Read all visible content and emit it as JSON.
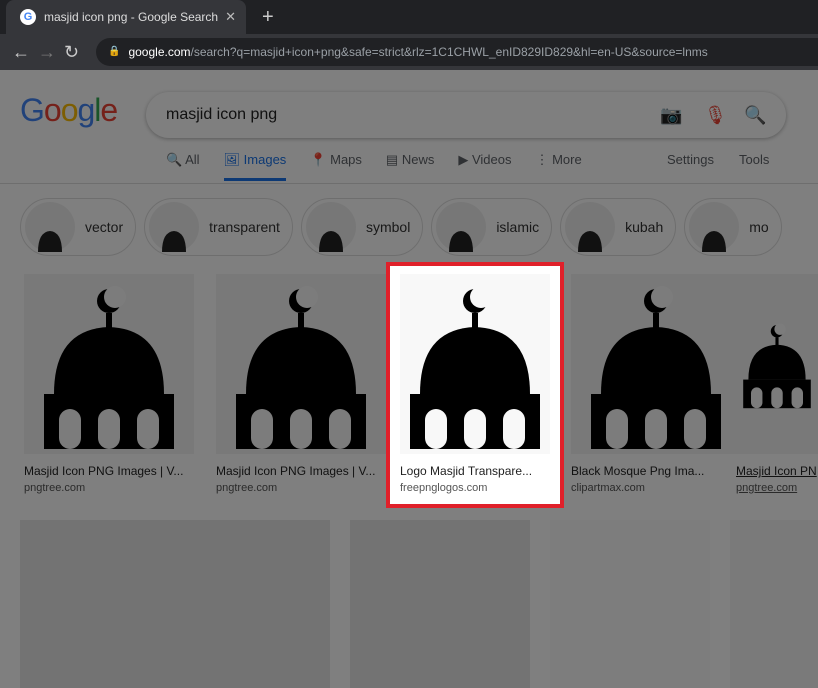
{
  "browser": {
    "tab_title": "masjid icon png - Google Search",
    "url_host": "google.com",
    "url_path": "/search?q=masjid+icon+png&safe=strict&rlz=1C1CHWL_enID829ID829&hl=en-US&source=lnms"
  },
  "search": {
    "query": "masjid icon png"
  },
  "nav": {
    "tabs": [
      "All",
      "Images",
      "Maps",
      "News",
      "Videos",
      "More"
    ],
    "settings": "Settings",
    "tools": "Tools"
  },
  "chips": [
    "vector",
    "transparent",
    "symbol",
    "islamic",
    "kubah",
    "mo"
  ],
  "results": [
    {
      "title": "Masjid Icon PNG Images | V...",
      "source": "pngtree.com"
    },
    {
      "title": "Masjid Icon PNG Images | V...",
      "source": "pngtree.com"
    },
    {
      "title": "Logo Masjid Transpare...",
      "source": "freepnglogos.com"
    },
    {
      "title": "Black Mosque Png Ima...",
      "source": "clipartmax.com"
    },
    {
      "title": "Masjid Icon PN",
      "source": "pngtree.com"
    }
  ],
  "colors": {
    "highlight": "#e0202a",
    "accent": "#1a73e8"
  }
}
